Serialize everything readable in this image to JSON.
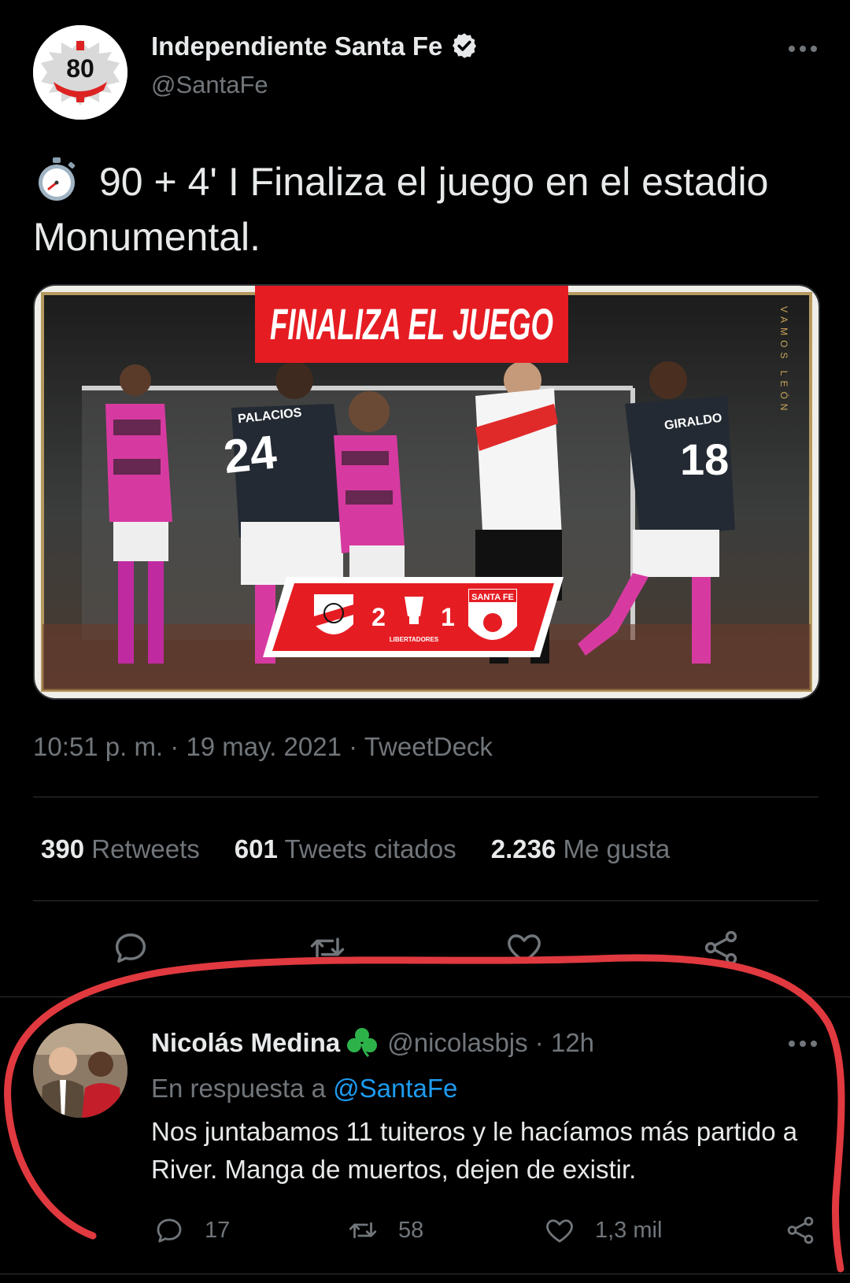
{
  "tweet": {
    "author": {
      "display_name": "Independiente Santa Fe",
      "handle": "@SantaFe",
      "avatar_text": "80"
    },
    "text": "90 + 4' I Finaliza el juego en el estadio Monumental.",
    "media": {
      "banner": "FINALIZA EL JUEGO",
      "home_score": "2",
      "away_score": "1",
      "competition": "LIBERTADORES",
      "away_team": "SANTA FE",
      "side_text": "VAMOS LEÓN",
      "player_left_name": "PALACIOS",
      "player_left_number": "24",
      "player_right_name": "GIRALDO",
      "player_right_number": "18"
    },
    "time": "10:51 p. m.",
    "date": "19 may. 2021",
    "source": "TweetDeck",
    "stats": {
      "retweets_count": "390",
      "retweets_label": "Retweets",
      "quotes_count": "601",
      "quotes_label": "Tweets citados",
      "likes_count": "2.236",
      "likes_label": "Me gusta"
    }
  },
  "reply": {
    "display_name": "Nicolás Medina",
    "handle": "@nicolasbjs",
    "time_ago": "12h",
    "reply_prefix": "En respuesta a",
    "reply_to": "@SantaFe",
    "text": "Nos juntabamos 11 tuiteros y le hacíamos más partido a River. Manga de muertos, dejen de existir.",
    "replies": "17",
    "retweets": "58",
    "likes": "1,3 mil"
  },
  "colors": {
    "accent": "#1d9bf0",
    "annotation": "#e0393f",
    "banner": "#e51d23"
  },
  "icons": [
    "verified-icon",
    "more-icon",
    "stopwatch-icon",
    "reply-icon",
    "retweet-icon",
    "like-icon",
    "share-icon",
    "clover-icon"
  ]
}
